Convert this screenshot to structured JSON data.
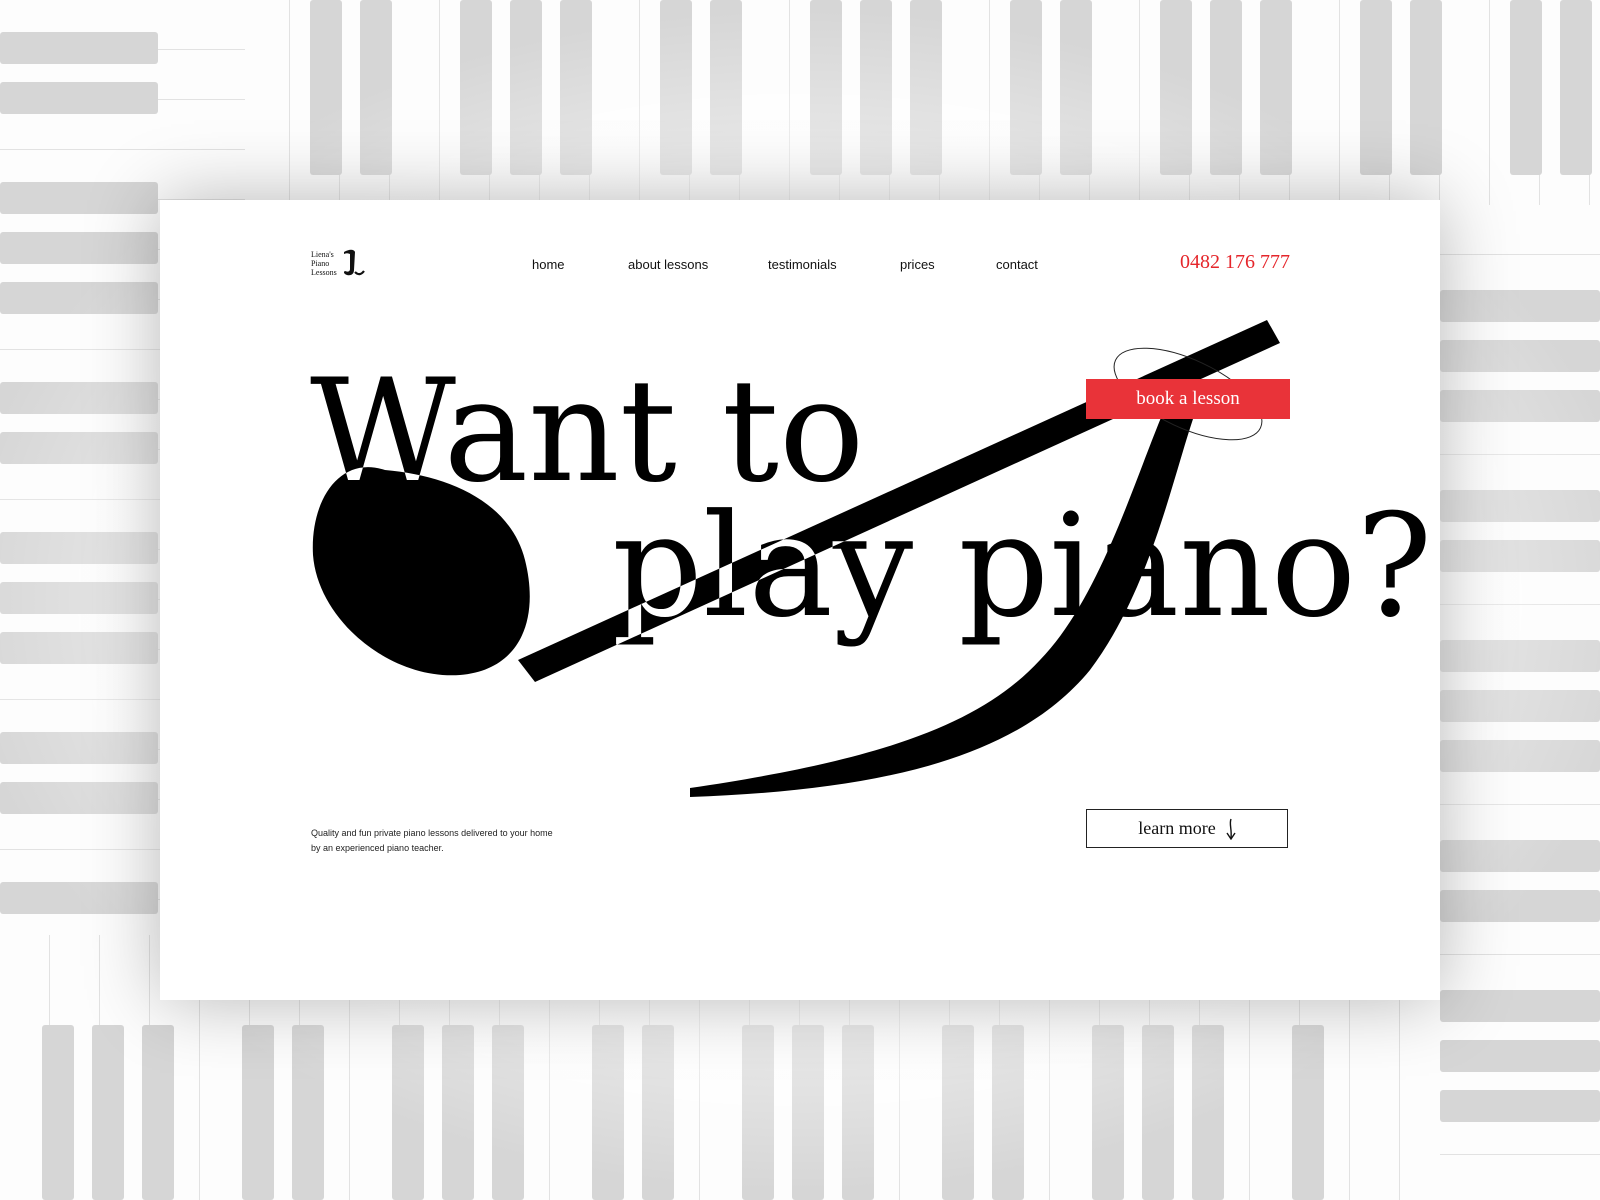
{
  "brand": {
    "line1": "Liena's",
    "line2": "Piano",
    "line3": "Lessons",
    "mark_icon": "stylized-L-monogram"
  },
  "nav": {
    "items": [
      {
        "label": "home"
      },
      {
        "label": "about lessons"
      },
      {
        "label": "testimonials"
      },
      {
        "label": "prices"
      },
      {
        "label": "contact"
      }
    ]
  },
  "phone": "0482 176 777",
  "hero": {
    "line1": "Want to",
    "line2": "play piano?",
    "illustration": "eighth-note-icon"
  },
  "cta": {
    "book_label": "book a lesson",
    "learn_label": "learn more",
    "learn_icon": "arrow-down-icon"
  },
  "tagline": {
    "line1": "Quality and fun private piano lessons delivered to your home",
    "line2": "by an experienced piano teacher."
  },
  "colors": {
    "accent": "#e93339",
    "text": "#111111",
    "background": "#ffffff"
  }
}
